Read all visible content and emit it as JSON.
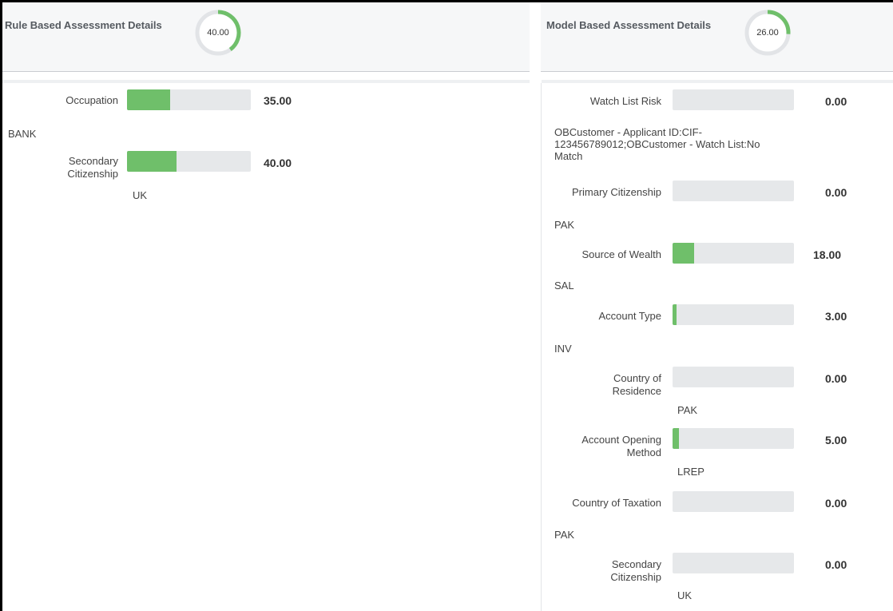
{
  "rule_panel": {
    "title": "Rule Based Assessment Details",
    "score_label": "40.00",
    "score_fraction": 0.4,
    "accent_color": "#6fbf6a",
    "items": [
      {
        "label": "Occupation",
        "value": "35.00",
        "fill": 0.35,
        "detail": "BANK"
      },
      {
        "label": "Secondary Citizenship",
        "value": "40.00",
        "fill": 0.4,
        "detail": "UK"
      }
    ]
  },
  "model_panel": {
    "title": "Model Based Assessment Details",
    "score_label": "26.00",
    "score_fraction": 0.26,
    "accent_color": "#6fbf6a",
    "items": [
      {
        "label": "Watch List Risk",
        "value": "0.00",
        "fill": 0.0,
        "detail": "OBCustomer - Applicant ID:CIF-123456789012;OBCustomer - Watch List:No Match"
      },
      {
        "label": "Primary Citizenship",
        "value": "0.00",
        "fill": 0.0,
        "detail": "PAK"
      },
      {
        "label": "Source of Wealth",
        "value": "18.00",
        "fill": 0.18,
        "detail": "SAL"
      },
      {
        "label": "Account Type",
        "value": "3.00",
        "fill": 0.03,
        "detail": "INV"
      },
      {
        "label": "Country of Residence",
        "value": "0.00",
        "fill": 0.0,
        "detail": "PAK"
      },
      {
        "label": "Account Opening Method",
        "value": "5.00",
        "fill": 0.05,
        "detail": "LREP"
      },
      {
        "label": "Country of Taxation",
        "value": "0.00",
        "fill": 0.0,
        "detail": "PAK"
      },
      {
        "label": "Secondary Citizenship",
        "value": "0.00",
        "fill": 0.0,
        "detail": "UK"
      }
    ]
  }
}
